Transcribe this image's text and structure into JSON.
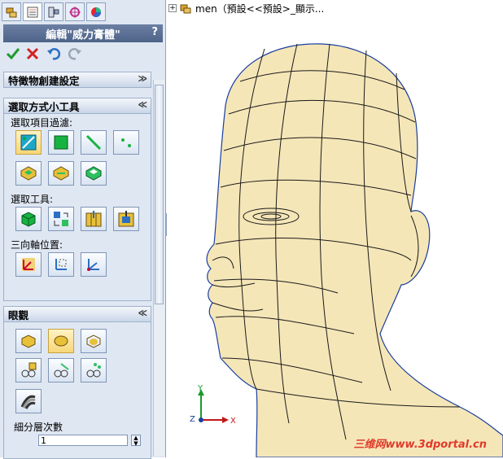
{
  "panel": {
    "tabs": [
      "feature-manager-icon",
      "property-manager-icon",
      "configuration-manager-icon",
      "dimxpert-icon",
      "display-manager-icon"
    ],
    "title": "編輯\"威力膏體\"",
    "help_label": "?",
    "sections": {
      "feature_create": {
        "title": "特徵物創建設定",
        "chevron": "≫"
      },
      "selection_tools": {
        "title": "選取方式小工具",
        "chevron": "≪",
        "filter_label": "選取項目過濾:",
        "tools_label": "選取工具:",
        "triad_label": "三向軸位置:"
      },
      "appearance": {
        "title": "眼觀",
        "chevron": "≪",
        "subdivision_label": "細分層次數",
        "subdivision_value": "1"
      }
    }
  },
  "view": {
    "tree_text": "men（預設<<預設>_顯示...",
    "axis": {
      "x": "X",
      "y": "Y",
      "z": "Z"
    },
    "watermark": "三维网www.3dportal.cn"
  },
  "colors": {
    "model_fill": "#f5e6b8",
    "model_edge": "#1a1a1a",
    "panel_bg": "#dfe7f2",
    "accent": "#2a6fc4"
  }
}
